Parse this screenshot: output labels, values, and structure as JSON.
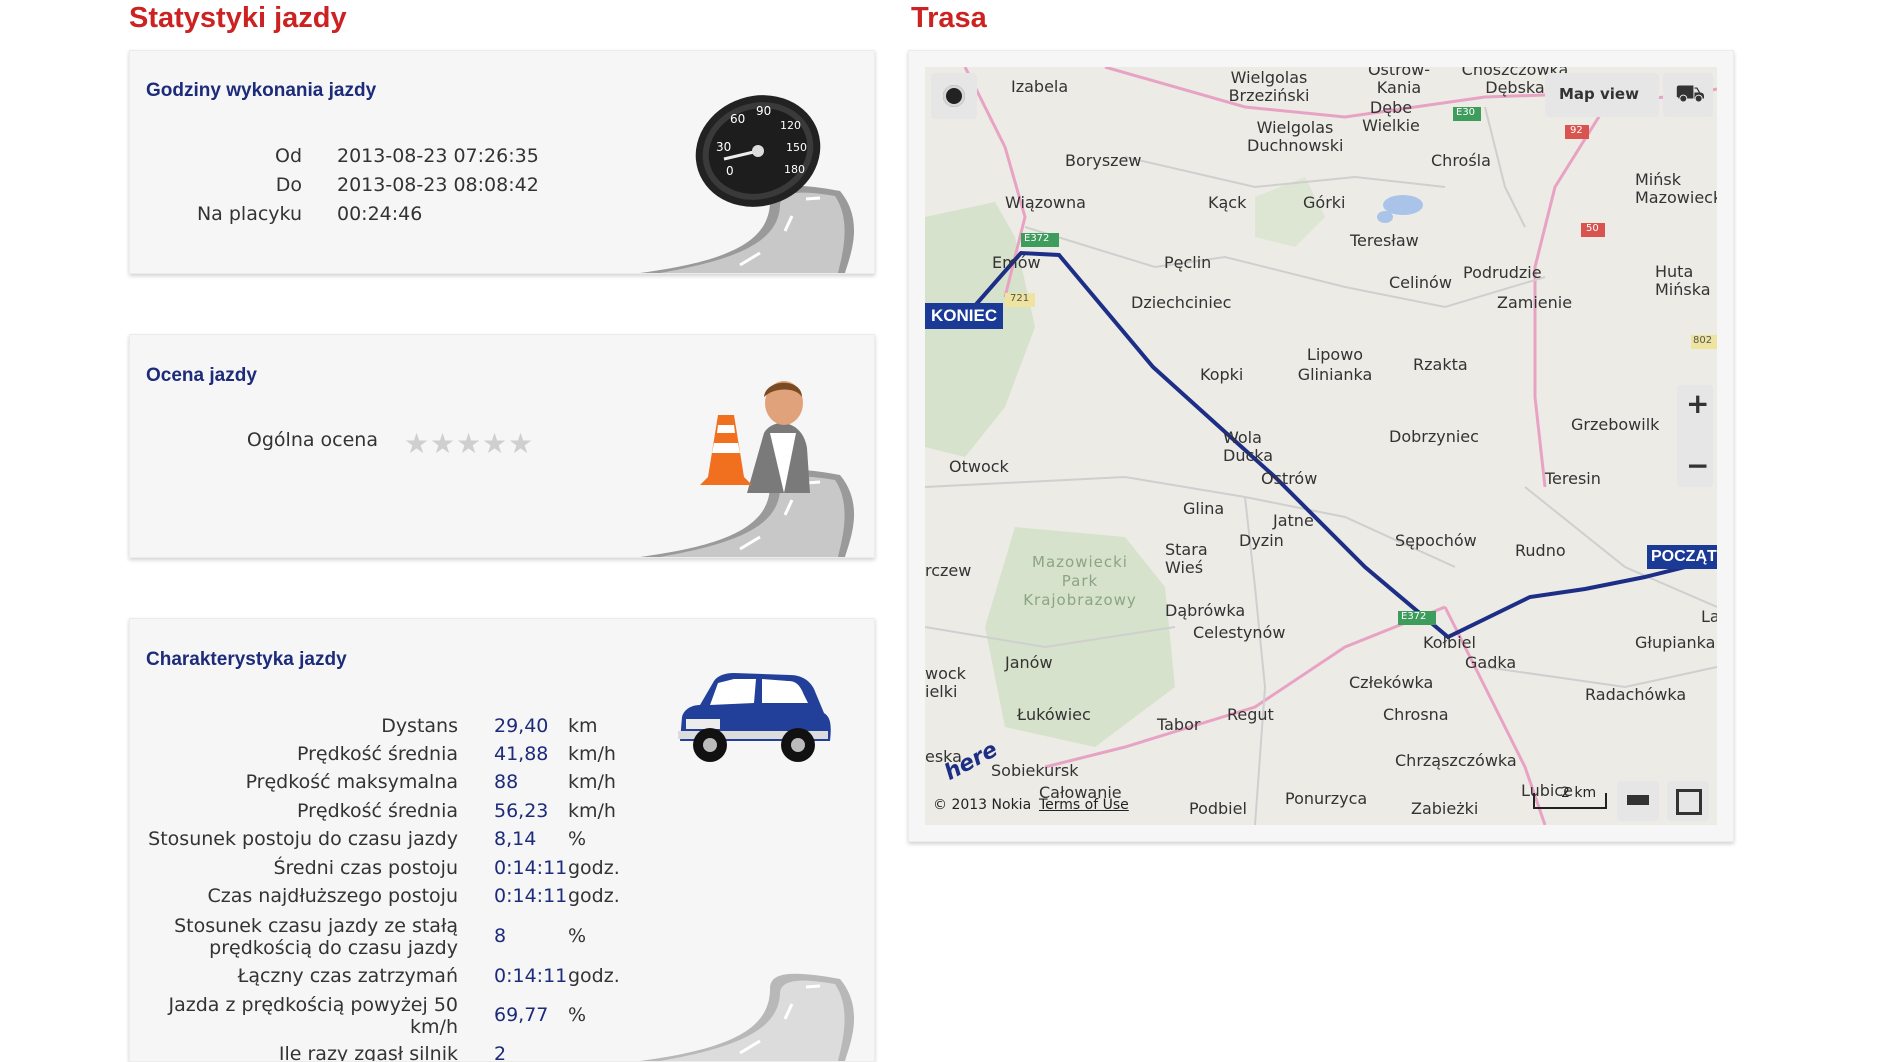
{
  "left_title": "Statystyki jazdy",
  "right_title": "Trasa",
  "hours": {
    "title": "Godziny wykonania jazdy",
    "rows": [
      {
        "label": "Od",
        "value": "2013-08-23 07:26:35"
      },
      {
        "label": "Do",
        "value": "2013-08-23 08:08:42"
      },
      {
        "label": "Na placyku",
        "value": "00:24:46"
      }
    ],
    "icon": "speedometer-icon"
  },
  "rating": {
    "title": "Ocena jazdy",
    "label": "Ogólna ocena",
    "stars": 0,
    "stars_max": 5,
    "icon": "instructor-cone-icon"
  },
  "stats": {
    "title": "Charakterystyka jazdy",
    "icon": "car-icon",
    "rows": [
      {
        "label": "Dystans",
        "value": "29,40",
        "unit": "km"
      },
      {
        "label": "Prędkość średnia",
        "value": "41,88",
        "unit": "km/h"
      },
      {
        "label": "Prędkość maksymalna",
        "value": "88",
        "unit": "km/h"
      },
      {
        "label": "Prędkość średnia",
        "value": "56,23",
        "unit": "km/h"
      },
      {
        "label": "Stosunek postoju do czasu jazdy",
        "value": "8,14",
        "unit": "%"
      },
      {
        "label": "Średni czas postoju",
        "value": "0:14:11",
        "unit": "godz."
      },
      {
        "label": "Czas najdłuższego postoju",
        "value": "0:14:11",
        "unit": "godz."
      },
      {
        "label": "Stosunek czasu jazdy ze stałą prędkością do czasu jazdy",
        "value": "8",
        "unit": "%"
      },
      {
        "label": "Łączny czas zatrzymań",
        "value": "0:14:11",
        "unit": "godz."
      },
      {
        "label": "Jazda z prędkością powyżej 50 km/h",
        "value": "69,77",
        "unit": "%"
      },
      {
        "label": "Ile razy zgasł silnik",
        "value": "2",
        "unit": ""
      }
    ]
  },
  "map": {
    "view_button": "Map view",
    "start_marker": "POCZĄTEK",
    "end_marker": "KONIEC",
    "copyright": "© 2013 Nokia",
    "terms": "Terms of Use",
    "scale": "2 km",
    "zoom_in": "+",
    "zoom_out": "−",
    "logo": "here",
    "park_label": "Mazowiecki Park Krajobrazowy",
    "road_badges": [
      "E30",
      "92",
      "50",
      "E372",
      "721",
      "E372",
      "802"
    ],
    "places": [
      "Izabela",
      "Wielgolas Brzeziński",
      "Ostrów-Kania",
      "Choszczówka Dębska",
      "Dębe Wielkie",
      "Wielgolas Duchnowski",
      "Boryszew",
      "Chrośla",
      "Mińsk Mazowiecki",
      "Wiązowna",
      "Kąck",
      "Górki",
      "Teresław",
      "Emów",
      "Pęclin",
      "Celinów",
      "Podrudzie",
      "Huta Mińska",
      "Dziechciniec",
      "Zamienie",
      "Lipowo Glinianka",
      "Rzakta",
      "Kopki",
      "Grzebowilk",
      "Wola Ducka",
      "Dobrzyniec",
      "Otwock",
      "Ostrów",
      "Teresin",
      "Glina",
      "Jatne",
      "Dyzin",
      "Sępochów",
      "Rudno",
      "Stara Wieś",
      "Dąbrówka",
      "Celestynów",
      "Kołbiel",
      "Gadka",
      "Głupianka",
      "Janów",
      "Człekówka",
      "Radachówka",
      "Łukówiec",
      "Regut",
      "Tabor",
      "Chrosna",
      "Sobiekursk",
      "Chrząszczówka",
      "Podbiel",
      "Ponurzyca",
      "Zabieżki",
      "Lubice",
      "Całowanie",
      "La",
      "rczew",
      "wock ielki",
      "eska"
    ]
  }
}
